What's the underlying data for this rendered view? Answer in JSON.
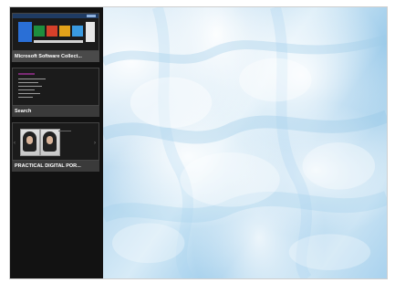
{
  "switcher": {
    "apps": [
      {
        "label": "Microsoft Software Collect..."
      },
      {
        "label": "Search"
      },
      {
        "label": "PRACTICAL DIGITAL POR..."
      }
    ]
  },
  "colors": {
    "switcher_bg": "#121212",
    "label_bg": "#3a3a3a",
    "store_header": "#1f3b63",
    "desktop_ice": "#b3d6ee"
  },
  "desktop": {
    "background": "ice-wallpaper"
  }
}
